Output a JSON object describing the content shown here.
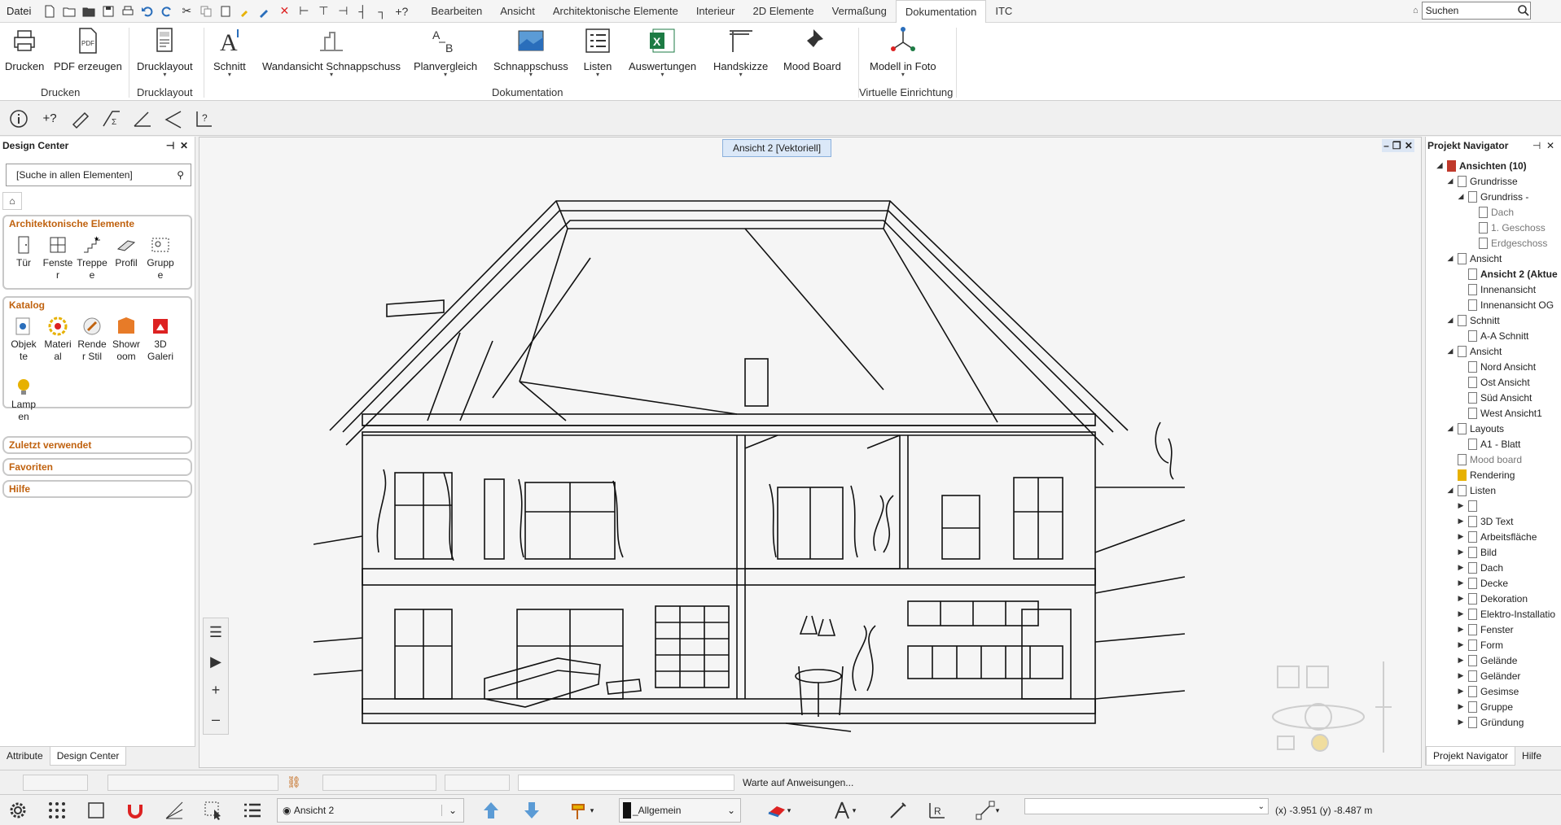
{
  "menu": {
    "file": "Datei",
    "tabs": [
      "Bearbeiten",
      "Ansicht",
      "Architektonische Elemente",
      "Interieur",
      "2D Elemente",
      "Vermaßung",
      "Dokumentation",
      "ITC"
    ],
    "active_tab": "Dokumentation",
    "search_placeholder": "Suchen"
  },
  "ribbon": {
    "buttons": {
      "drucken": "Drucken",
      "pdf": "PDF erzeugen",
      "drucklayout": "Drucklayout",
      "schnitt": "Schnitt",
      "wandansicht": "Wandansicht Schnappschuss",
      "planvergleich": "Planvergleich",
      "schnappschuss": "Schnappschuss",
      "listen": "Listen",
      "auswertungen": "Auswertungen",
      "handskizze": "Handskizze",
      "moodboard": "Mood Board",
      "modell": "Modell in Foto"
    },
    "groups": {
      "drucken": "Drucken",
      "drucklayout": "Drucklayout",
      "dokumentation": "Dokumentation",
      "virtuell": "Virtuelle Einrichtung"
    }
  },
  "design_center": {
    "title": "Design Center",
    "search": "[Suche in allen Elementen]",
    "arch_title": "Architektonische Elemente",
    "arch_items": [
      "Tür",
      "Fenste\nr",
      "Treppe\ne",
      "Profil",
      "Grupp\ne"
    ],
    "katalog_title": "Katalog",
    "katalog_items": [
      "Objek\nte",
      "Materi\nal",
      "Rende\nr Stil",
      "Showr\noom",
      "3D\nGaleri",
      "Lamp\nen"
    ],
    "collapsed": [
      "Zuletzt verwendet",
      "Favoriten",
      "Hilfe"
    ],
    "tabs": [
      "Attribute",
      "Design Center"
    ]
  },
  "canvas": {
    "view_tab": "Ansicht 2 [Vektoriell]"
  },
  "navigator": {
    "title": "Projekt Navigator",
    "rows": [
      {
        "label": "Ansichten (10)",
        "lvl": 0,
        "arrow": "◢",
        "bold": true
      },
      {
        "label": "Grundrisse",
        "lvl": 1,
        "arrow": "◢"
      },
      {
        "label": "Grundriss -",
        "lvl": 2,
        "arrow": "◢"
      },
      {
        "label": "Dach",
        "lvl": 3,
        "arrow": "",
        "muted": true
      },
      {
        "label": "1. Geschoss",
        "lvl": 3,
        "arrow": "",
        "muted": true
      },
      {
        "label": "Erdgeschoss",
        "lvl": 3,
        "arrow": "",
        "muted": true
      },
      {
        "label": "Ansicht",
        "lvl": 1,
        "arrow": "◢"
      },
      {
        "label": "Ansicht 2 (Aktue",
        "lvl": 2,
        "arrow": "",
        "bold": true
      },
      {
        "label": "Innenansicht",
        "lvl": 2,
        "arrow": ""
      },
      {
        "label": "Innenansicht OG",
        "lvl": 2,
        "arrow": ""
      },
      {
        "label": "Schnitt",
        "lvl": 1,
        "arrow": "◢"
      },
      {
        "label": "A-A Schnitt",
        "lvl": 2,
        "arrow": ""
      },
      {
        "label": "Ansicht",
        "lvl": 1,
        "arrow": "◢"
      },
      {
        "label": "Nord Ansicht",
        "lvl": 2,
        "arrow": ""
      },
      {
        "label": "Ost Ansicht",
        "lvl": 2,
        "arrow": ""
      },
      {
        "label": "Süd Ansicht",
        "lvl": 2,
        "arrow": ""
      },
      {
        "label": "West Ansicht1",
        "lvl": 2,
        "arrow": ""
      },
      {
        "label": "Layouts",
        "lvl": 1,
        "arrow": "◢"
      },
      {
        "label": "A1 - Blatt",
        "lvl": 2,
        "arrow": ""
      },
      {
        "label": "Mood board",
        "lvl": 1,
        "arrow": "",
        "muted": true
      },
      {
        "label": "Rendering",
        "lvl": 1,
        "arrow": ""
      },
      {
        "label": "Listen",
        "lvl": 1,
        "arrow": "◢"
      },
      {
        "label": "",
        "lvl": 2,
        "arrow": "▶"
      },
      {
        "label": "3D Text",
        "lvl": 2,
        "arrow": "▶"
      },
      {
        "label": "Arbeitsfläche",
        "lvl": 2,
        "arrow": "▶"
      },
      {
        "label": "Bild",
        "lvl": 2,
        "arrow": "▶"
      },
      {
        "label": "Dach",
        "lvl": 2,
        "arrow": "▶"
      },
      {
        "label": "Decke",
        "lvl": 2,
        "arrow": "▶"
      },
      {
        "label": "Dekoration",
        "lvl": 2,
        "arrow": "▶"
      },
      {
        "label": "Elektro-Installatio",
        "lvl": 2,
        "arrow": "▶"
      },
      {
        "label": "Fenster",
        "lvl": 2,
        "arrow": "▶"
      },
      {
        "label": "Form",
        "lvl": 2,
        "arrow": "▶"
      },
      {
        "label": "Gelände",
        "lvl": 2,
        "arrow": "▶"
      },
      {
        "label": "Geländer",
        "lvl": 2,
        "arrow": "▶"
      },
      {
        "label": "Gesimse",
        "lvl": 2,
        "arrow": "▶"
      },
      {
        "label": "Gruppe",
        "lvl": 2,
        "arrow": "▶"
      },
      {
        "label": "Gründung",
        "lvl": 2,
        "arrow": "▶"
      }
    ],
    "tabs": [
      "Projekt Navigator",
      "Hilfe"
    ]
  },
  "status": {
    "message": "Warte auf Anweisungen...",
    "view_select": "Ansicht 2",
    "layer_select": "_Allgemein",
    "coords": "(x) -3.951   (y) -8.487 m"
  },
  "colors": {
    "accent": "#c0620f",
    "select_blue": "#dbe8f8"
  }
}
